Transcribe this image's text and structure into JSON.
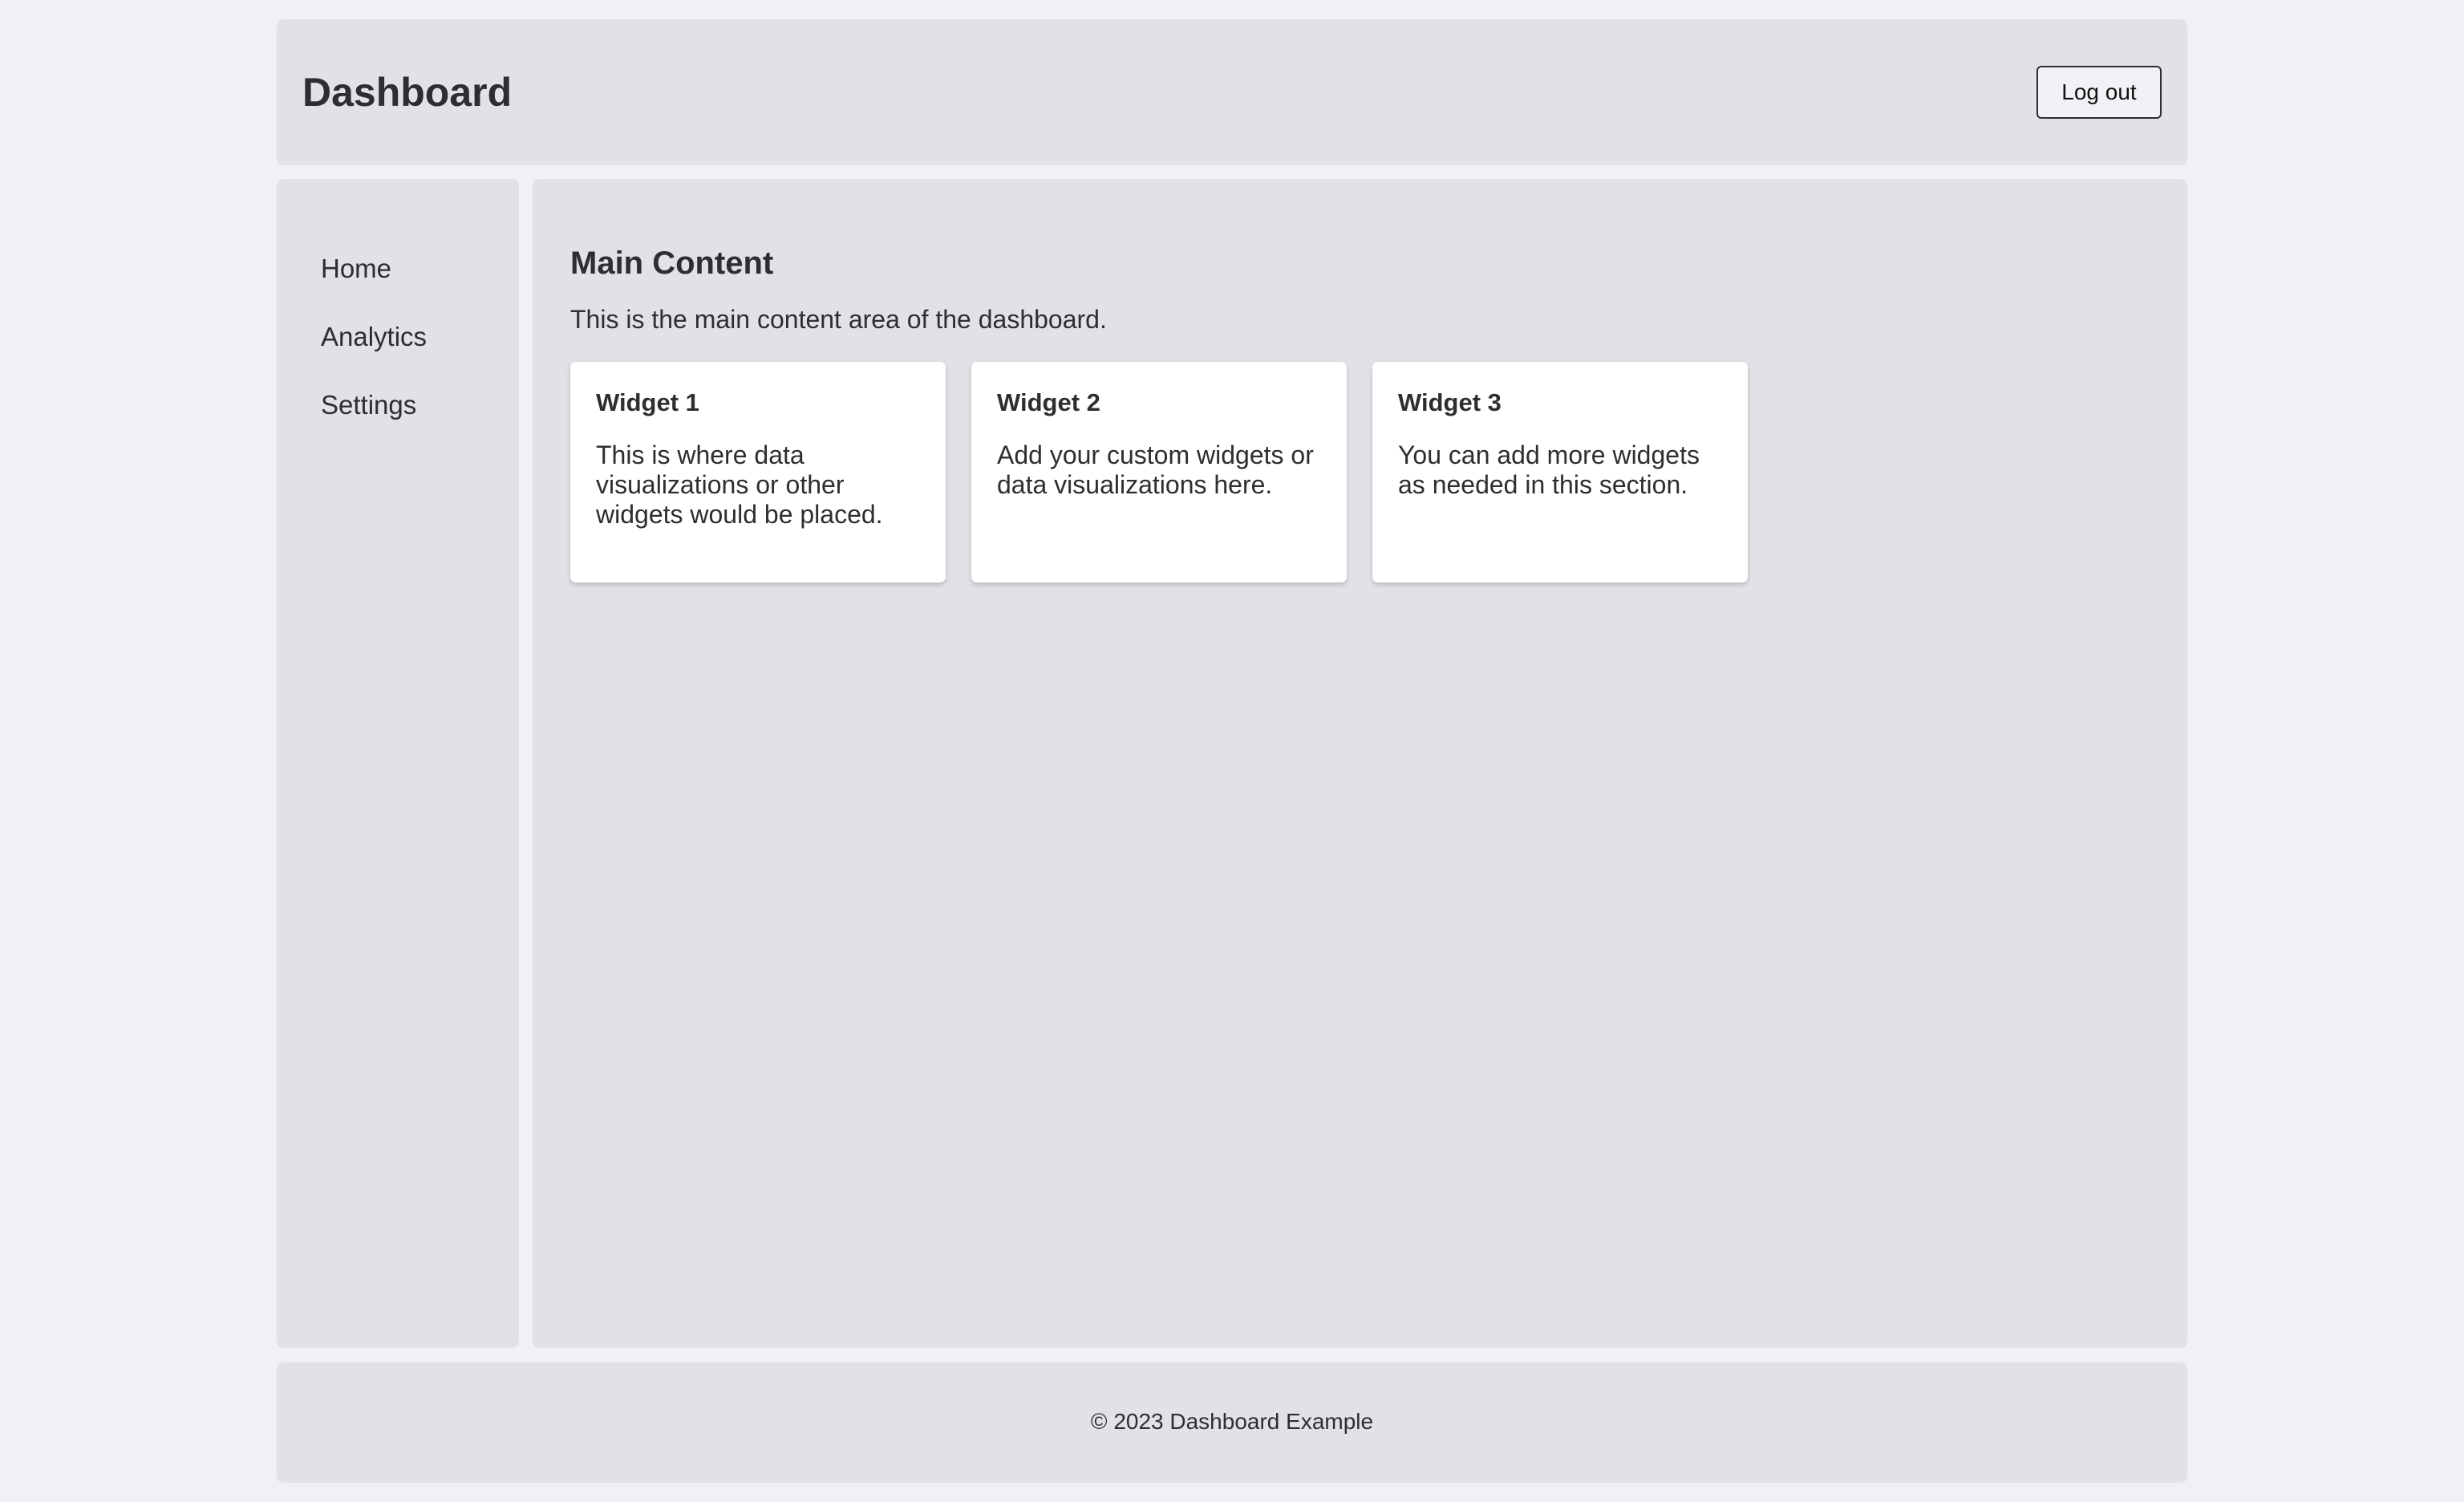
{
  "header": {
    "title": "Dashboard",
    "logout_label": "Log out"
  },
  "sidebar": {
    "items": [
      {
        "label": "Home"
      },
      {
        "label": "Analytics"
      },
      {
        "label": "Settings"
      }
    ]
  },
  "main": {
    "title": "Main Content",
    "description": "This is the main content area of the dashboard.",
    "widgets": [
      {
        "title": "Widget 1",
        "text": "This is where data visualizations or other widgets would be placed."
      },
      {
        "title": "Widget 2",
        "text": "Add your custom widgets or data visualizations here."
      },
      {
        "title": "Widget 3",
        "text": "You can add more widgets as needed in this section."
      }
    ]
  },
  "footer": {
    "text": "© 2023 Dashboard Example"
  },
  "colors": {
    "page_background": "#f0f1f5",
    "panel_background": "#e1e2e7",
    "widget_background": "#ffffff",
    "text": "#2e2e30"
  }
}
